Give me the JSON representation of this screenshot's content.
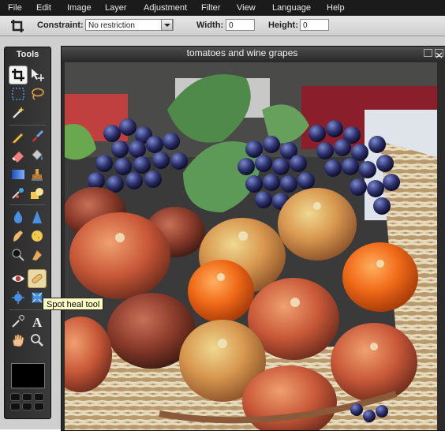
{
  "menu": [
    "File",
    "Edit",
    "Image",
    "Layer",
    "Adjustment",
    "Filter",
    "View",
    "Language",
    "Help"
  ],
  "options": {
    "constraint_label": "Constraint:",
    "constraint_value": "No restriction",
    "width_label": "Width:",
    "width_value": "0",
    "height_label": "Height:",
    "height_value": "0"
  },
  "tools_panel": {
    "title": "Tools",
    "tools": [
      "crop",
      "move",
      "marquee-select",
      "lasso-select",
      "magic-wand",
      "pencil",
      "brush",
      "eraser",
      "color-replace",
      "gradient",
      "clone-stamp",
      "replace-color",
      "shape",
      "blur",
      "sharpen",
      "smudge",
      "sponge",
      "zoom-in-dodge",
      "burn",
      "red-eye",
      "spot-heal",
      "bloat",
      "pinch",
      "color-picker",
      "type",
      "hand",
      "zoom"
    ],
    "active_tool": "crop",
    "hover_tool": "spot-heal",
    "primary_color": "#000000"
  },
  "document": {
    "title": "tomatoes and wine grapes"
  },
  "tooltip": "Spot heal tool",
  "colors": {
    "menubar_bg": "#1b1b1b",
    "panel_bg": "#2c2c2c",
    "tooltip_bg": "#ffffc4"
  }
}
